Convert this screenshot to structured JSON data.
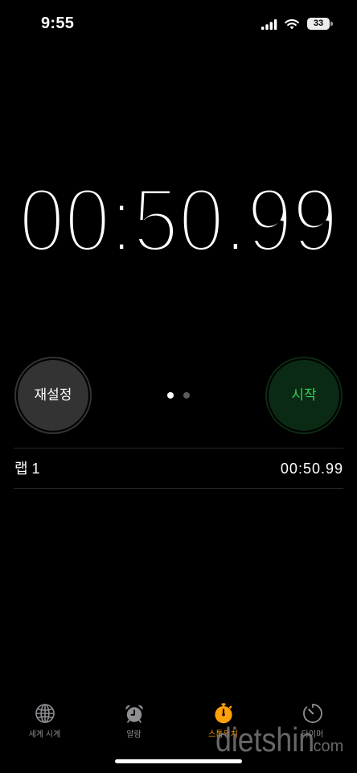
{
  "status_bar": {
    "time": "9:55",
    "battery_percent": "33",
    "icons": [
      "cellular-signal-icon",
      "wifi-icon",
      "battery-icon"
    ]
  },
  "stopwatch": {
    "elapsed": "00:50.99"
  },
  "controls": {
    "reset_label": "재설정",
    "start_label": "시작"
  },
  "page_indicator": {
    "pages": 2,
    "current_page": 1
  },
  "laps": [
    {
      "label": "랩 1",
      "time": "00:50.99"
    }
  ],
  "tab_bar": {
    "tabs": [
      {
        "label": "세계 시계",
        "icon": "globe-icon",
        "active": false
      },
      {
        "label": "알람",
        "icon": "alarm-clock-icon",
        "active": false
      },
      {
        "label": "스톱워치",
        "icon": "stopwatch-icon",
        "active": true
      },
      {
        "label": "타이머",
        "icon": "timer-icon",
        "active": false
      }
    ]
  },
  "watermark": {
    "main": "dietshin",
    "suffix": ".com"
  },
  "colors": {
    "background": "#000000",
    "accent": "#ff9f0a",
    "start_text": "#30d158",
    "start_background": "#0b2a13",
    "reset_background": "#333333",
    "inactive_tab": "#8e8e93",
    "divider": "#262626"
  }
}
